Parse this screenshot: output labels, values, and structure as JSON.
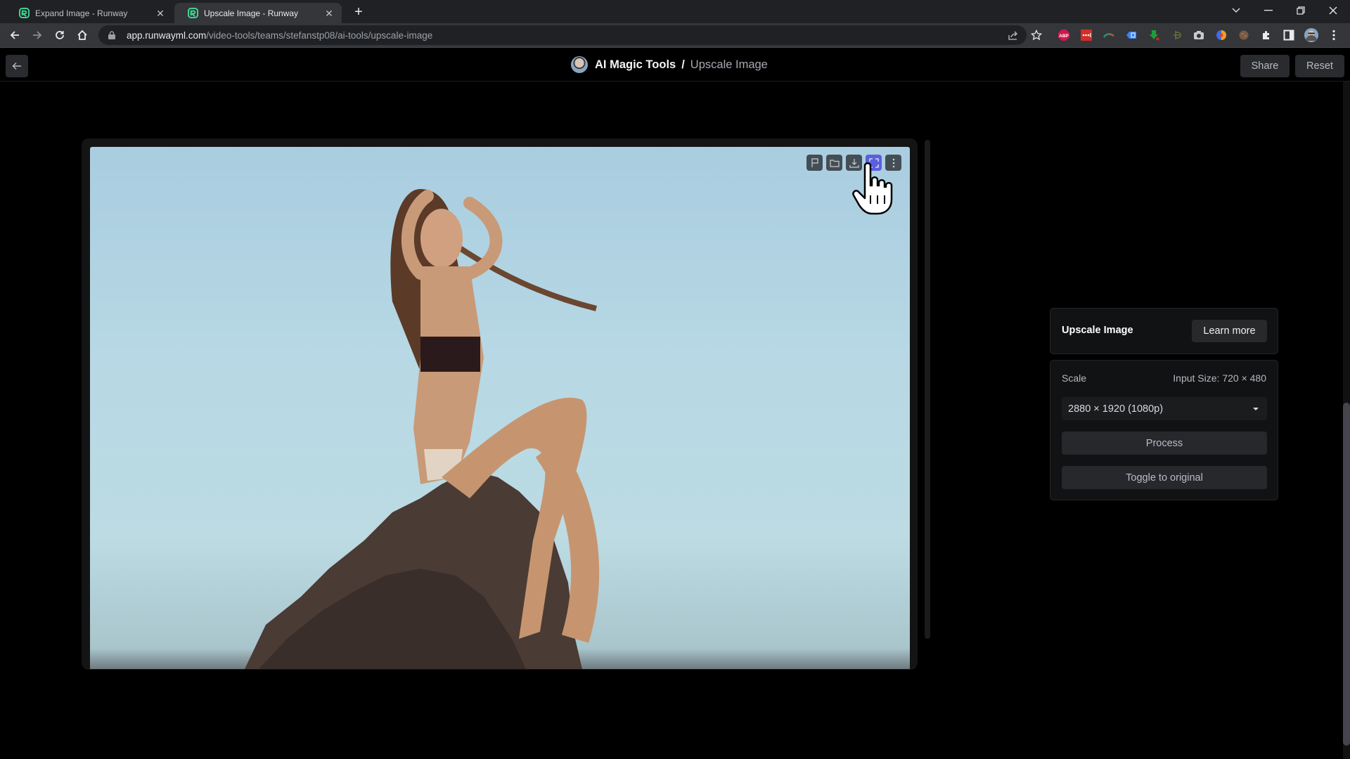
{
  "browser": {
    "tabs": [
      {
        "title": "Expand Image - Runway",
        "active": false,
        "icon": "runway-logo-icon"
      },
      {
        "title": "Upscale Image - Runway",
        "active": true,
        "icon": "runway-logo-icon"
      }
    ],
    "new_tab_label": "+",
    "url_host": "app.runwayml.com",
    "url_path": "/video-tools/teams/stefanstp08/ai-tools/upscale-image",
    "extensions": [
      "share-icon",
      "bookmark-star-icon",
      "adblock-plus-icon",
      "lastpass-icon",
      "extension-icon",
      "extension-icon",
      "download-icon",
      "extension-icon",
      "camera-icon",
      "extension-icon",
      "extension-icon",
      "puzzle-icon",
      "sidebar-icon",
      "profile-avatar",
      "menu-icon"
    ],
    "accent_color": "#3ddc97"
  },
  "header": {
    "breadcrumb_root": "AI Magic Tools",
    "breadcrumb_separator": "/",
    "breadcrumb_current": "Upscale Image",
    "share_label": "Share",
    "reset_label": "Reset"
  },
  "canvas": {
    "tools": [
      "flag-icon",
      "folder-icon",
      "download-icon",
      "expand-icon",
      "more-vertical-icon"
    ],
    "active_tool": "expand-icon",
    "active_color": "#5a5fdc"
  },
  "panel": {
    "title": "Upscale Image",
    "learn_more_label": "Learn more",
    "scale_label": "Scale",
    "input_size": "Input Size: 720 × 480",
    "scale_selected": "2880 × 1920 (1080p)",
    "process_label": "Process",
    "toggle_label": "Toggle to original"
  }
}
